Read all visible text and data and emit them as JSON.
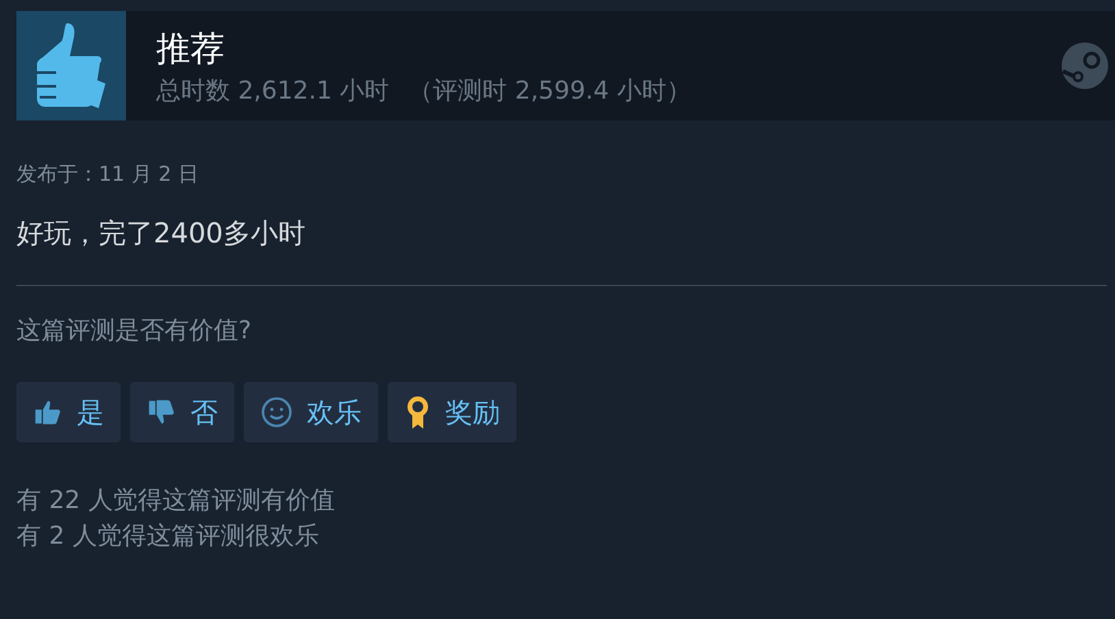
{
  "header": {
    "title": "推荐",
    "playtime": "总时数 2,612.1 小时",
    "review_playtime": "（评测时 2,599.4 小时）"
  },
  "posted": "发布于：11 月 2 日",
  "review_text": "好玩，完了2400多小时",
  "prompt": "这篇评测是否有价值?",
  "buttons": [
    {
      "kind": "thumbs-up",
      "label": "是"
    },
    {
      "kind": "thumbs-down",
      "label": "否"
    },
    {
      "kind": "smile",
      "label": "欢乐"
    },
    {
      "kind": "award",
      "label": "奖励"
    }
  ],
  "stats": [
    "有 22 人觉得这篇评测有价值",
    "有 2 人觉得这篇评测很欢乐"
  ]
}
